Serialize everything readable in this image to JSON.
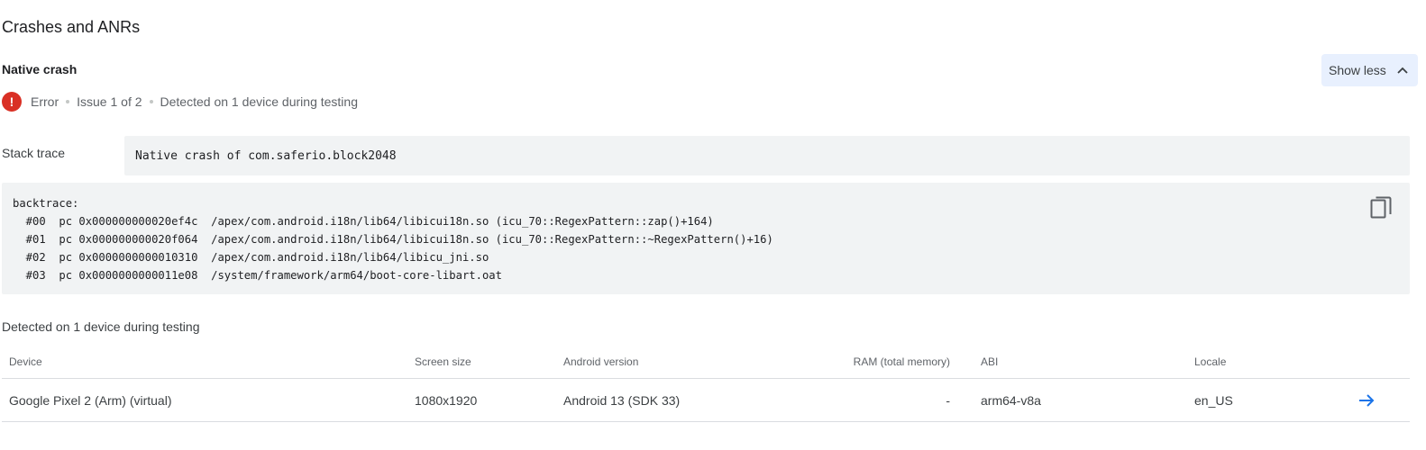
{
  "section": {
    "title": "Crashes and ANRs"
  },
  "issue": {
    "title": "Native crash",
    "show_less_label": "Show less",
    "status": {
      "severity": "Error",
      "issue_count": "Issue 1 of 2",
      "detected": "Detected on 1 device during testing"
    }
  },
  "stack": {
    "label": "Stack trace",
    "summary": "Native crash of com.saferio.block2048",
    "backtrace": "backtrace:\n  #00  pc 0x000000000020ef4c  /apex/com.android.i18n/lib64/libicui18n.so (icu_70::RegexPattern::zap()+164)\n  #01  pc 0x000000000020f064  /apex/com.android.i18n/lib64/libicui18n.so (icu_70::RegexPattern::~RegexPattern()+16)\n  #02  pc 0x0000000000010310  /apex/com.android.i18n/lib64/libicu_jni.so\n  #03  pc 0x0000000000011e08  /system/framework/arm64/boot-core-libart.oat"
  },
  "devices": {
    "label": "Detected on 1 device during testing",
    "columns": {
      "device": "Device",
      "screen": "Screen size",
      "android": "Android version",
      "ram": "RAM (total memory)",
      "abi": "ABI",
      "locale": "Locale"
    },
    "rows": [
      {
        "device": "Google Pixel 2 (Arm) (virtual)",
        "screen": "1080x1920",
        "android": "Android 13 (SDK 33)",
        "ram": "-",
        "abi": "arm64-v8a",
        "locale": "en_US"
      }
    ]
  },
  "colors": {
    "error": "#d93025",
    "accent": "#1a73e8",
    "button_bg": "#e8f0fe",
    "code_bg": "#f1f3f4"
  },
  "icons": {
    "error": "exclamation-circle",
    "chevron": "chevron-up",
    "copy": "content-copy",
    "arrow": "arrow-right"
  }
}
